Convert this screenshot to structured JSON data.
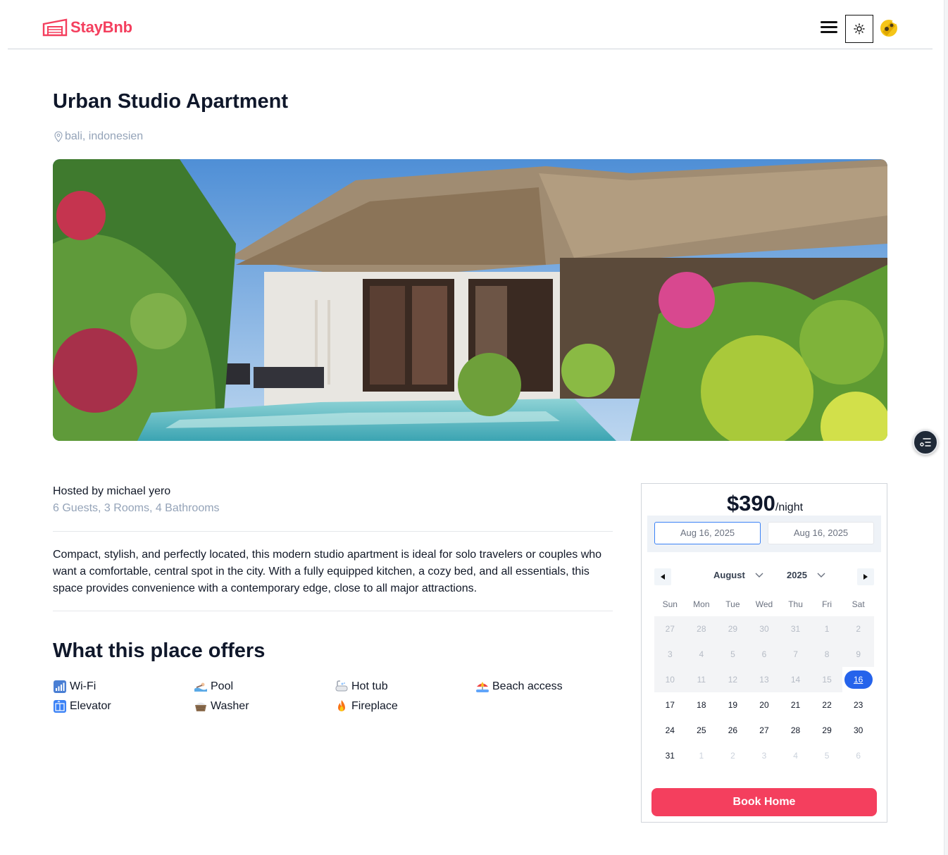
{
  "header": {
    "logo_text": "StayBnb"
  },
  "listing": {
    "title": "Urban Studio Apartment",
    "location": "bali, indonesien",
    "hosted_by": "Hosted by michael yero",
    "stats": "6 Guests, 3 Rooms, 4 Bathrooms",
    "description": "Compact, stylish, and perfectly located, this modern studio apartment is ideal for solo travelers or couples who want a comfortable, central spot in the city. With a fully equipped kitchen, a cozy bed, and all essentials, this space provides convenience with a contemporary edge, close to all major attractions."
  },
  "offers": {
    "title": "What this place offers",
    "items": [
      {
        "label": "Wi-Fi",
        "icon": "wifi-icon"
      },
      {
        "label": "Pool",
        "icon": "pool-icon"
      },
      {
        "label": "Hot tub",
        "icon": "hot-tub-icon"
      },
      {
        "label": "Beach access",
        "icon": "beach-icon"
      },
      {
        "label": "Elevator",
        "icon": "elevator-icon"
      },
      {
        "label": "Washer",
        "icon": "washer-icon"
      },
      {
        "label": "Fireplace",
        "icon": "fireplace-icon"
      }
    ]
  },
  "booking": {
    "price": "$390",
    "price_unit": "/night",
    "check_in": "Aug 16, 2025",
    "check_out": "Aug 16, 2025",
    "month": "August",
    "year": "2025",
    "weekdays": [
      "Sun",
      "Mon",
      "Tue",
      "Wed",
      "Thu",
      "Fri",
      "Sat"
    ],
    "weeks": [
      [
        "27",
        "28",
        "29",
        "30",
        "31",
        "1",
        "2"
      ],
      [
        "3",
        "4",
        "5",
        "6",
        "7",
        "8",
        "9"
      ],
      [
        "10",
        "11",
        "12",
        "13",
        "14",
        "15",
        "16"
      ],
      [
        "17",
        "18",
        "19",
        "20",
        "21",
        "22",
        "23"
      ],
      [
        "24",
        "25",
        "26",
        "27",
        "28",
        "29",
        "30"
      ],
      [
        "31",
        "1",
        "2",
        "3",
        "4",
        "5",
        "6"
      ]
    ],
    "selected_day": "16",
    "book_label": "Book Home"
  },
  "colors": {
    "brand": "#f43f5e",
    "selected": "#2563eb"
  }
}
